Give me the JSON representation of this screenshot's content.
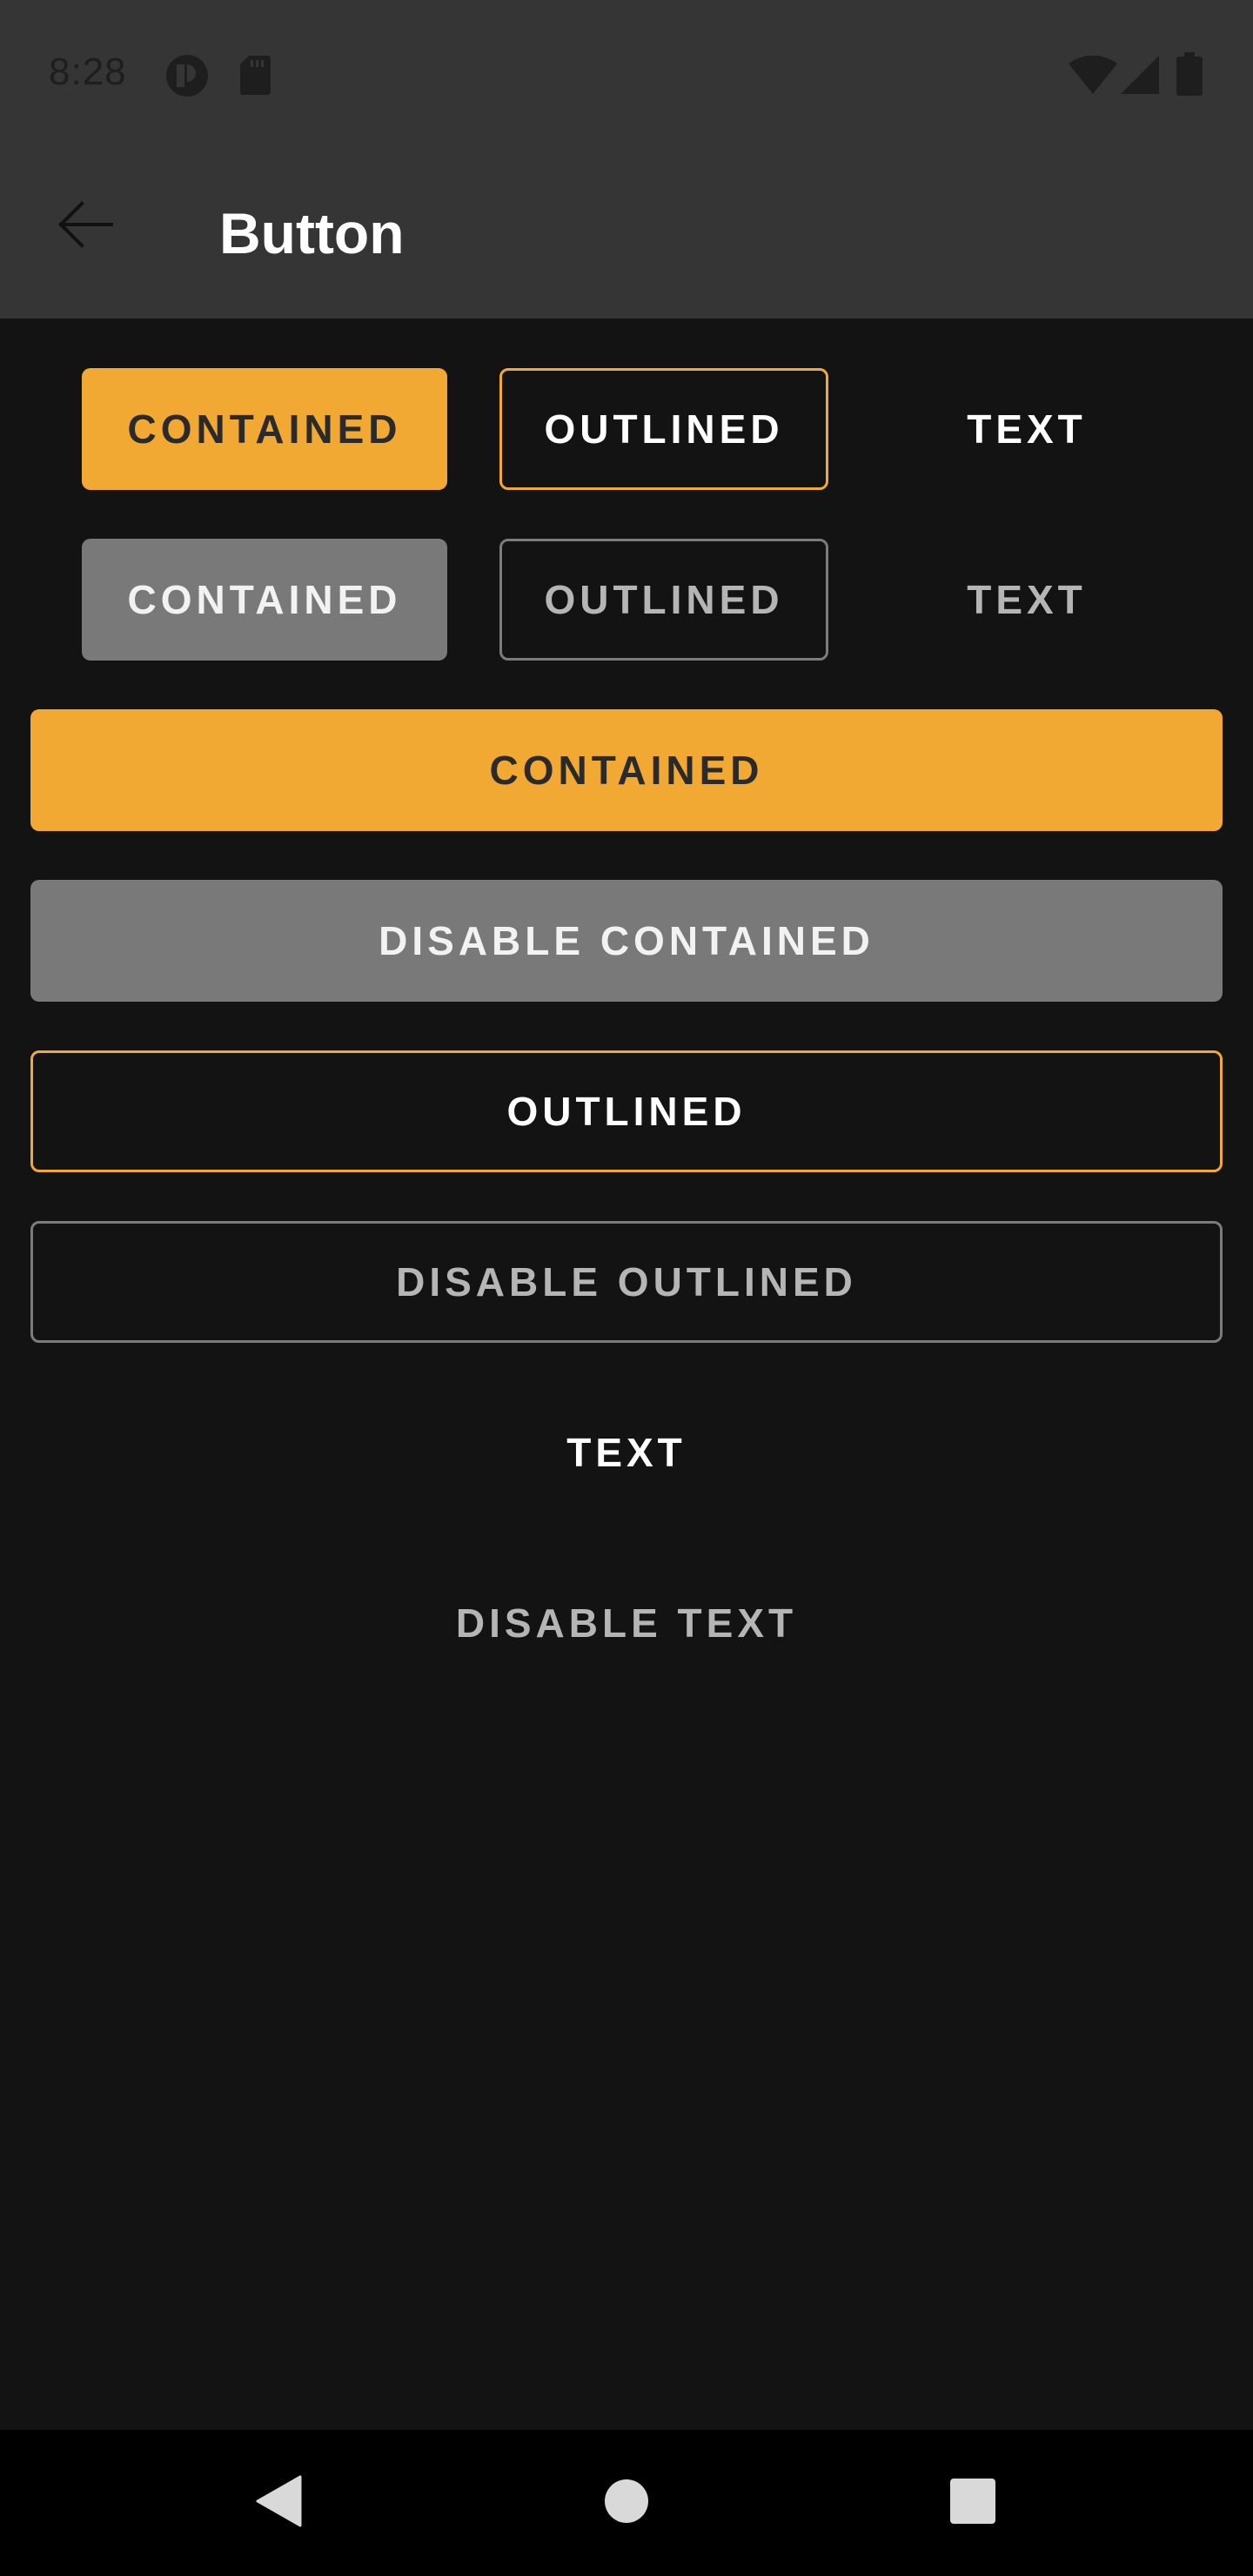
{
  "status_bar": {
    "time": "8:28",
    "icons": [
      "app-notification-icon",
      "sd-card-icon",
      "wifi-icon",
      "signal-icon",
      "battery-icon"
    ]
  },
  "app_bar": {
    "back_icon": "arrow-back-icon",
    "title": "Button"
  },
  "buttons": {
    "row1": {
      "contained": "CONTAINED",
      "outlined": "OUTLINED",
      "text": "TEXT"
    },
    "row2": {
      "contained": "CONTAINED",
      "outlined": "OUTLINED",
      "text": "TEXT"
    },
    "full_width": {
      "contained": "CONTAINED",
      "disable_contained": "DISABLE CONTAINED",
      "outlined": "OUTLINED",
      "disable_outlined": "DISABLE OUTLINED",
      "text": "TEXT",
      "disable_text": "DISABLE TEXT"
    }
  },
  "nav_bar": {
    "back": "nav-back-icon",
    "home": "nav-home-icon",
    "recents": "nav-recents-icon"
  },
  "colors": {
    "accent": "#f2a933",
    "disabled_fill": "#797979",
    "background": "#131313",
    "app_bar": "#353535"
  }
}
